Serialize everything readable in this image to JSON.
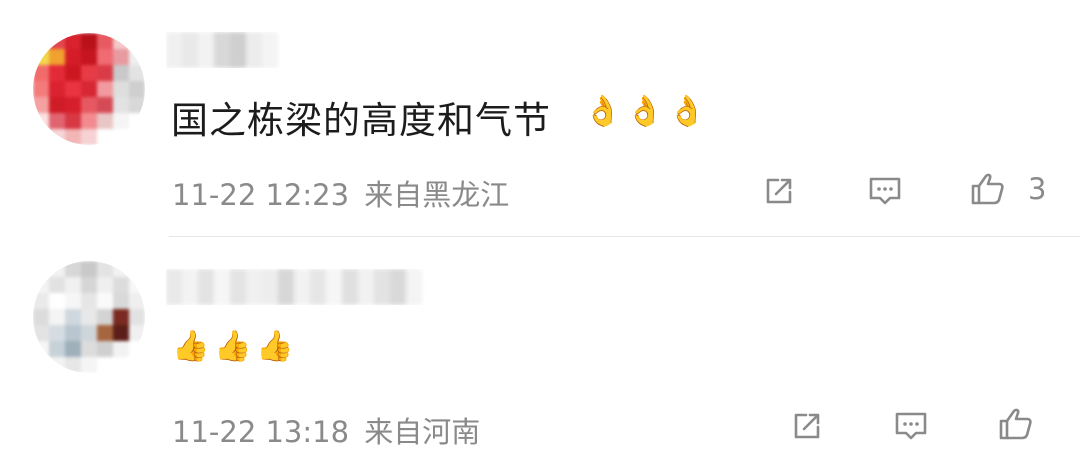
{
  "comments": [
    {
      "avatar_colors": [
        "#d7202b",
        "#e83442",
        "#f26b6b",
        "#c8121c",
        "#f4c94a",
        "#cfcfcf"
      ],
      "text": "国之栋梁的高度和气节",
      "emoji": "👌",
      "time": "11-22 12:23",
      "location": "来自黑龙江",
      "likes": "3"
    },
    {
      "avatar_colors": [
        "#d6d6d6",
        "#e9e9e9",
        "#b9c6cf",
        "#7a2a20",
        "#f0f0f0",
        "#c7c7c7"
      ],
      "text": "",
      "emoji": "👍",
      "time": "11-22 13:18",
      "location": "来自河南",
      "likes": ""
    }
  ],
  "icons": {
    "share": "share-icon",
    "comment": "comment-icon",
    "like": "thumbs-up-icon"
  },
  "colors": {
    "meta_text": "#8a8a8a",
    "divider": "#e6e6e6"
  }
}
